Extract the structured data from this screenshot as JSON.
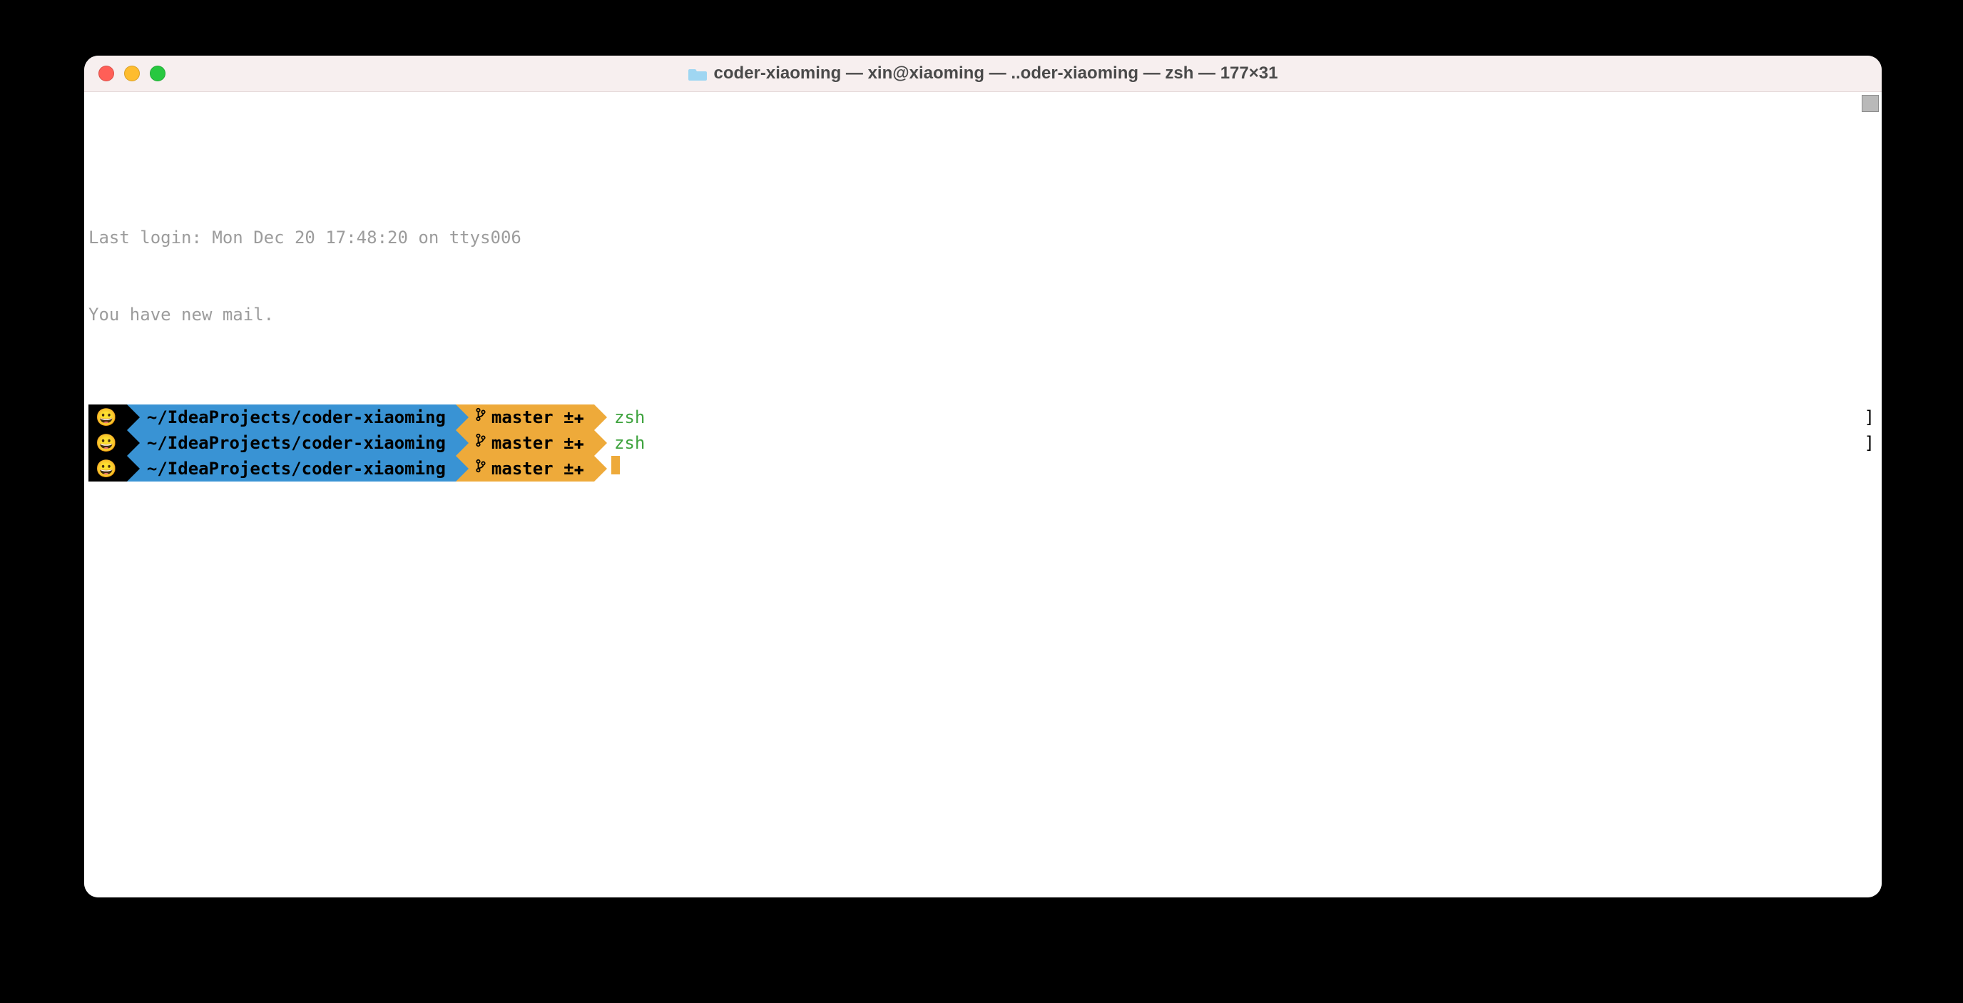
{
  "window": {
    "title": "coder-xiaoming — xin@xiaoming — ..oder-xiaoming — zsh — 177×31"
  },
  "terminal": {
    "lines": {
      "last_login": "Last login: Mon Dec 20 17:48:20 on ttys006",
      "mail": "You have new mail."
    },
    "prompt": {
      "emoji": "😀",
      "path": "~/IdeaProjects/coder-xiaoming",
      "branch": "master",
      "dirty": "±✚"
    },
    "rows": [
      {
        "command": "zsh",
        "right_bracket": "]",
        "cursor": false
      },
      {
        "command": "zsh",
        "right_bracket": "]",
        "cursor": false
      },
      {
        "command": "",
        "right_bracket": "",
        "cursor": true
      }
    ]
  }
}
